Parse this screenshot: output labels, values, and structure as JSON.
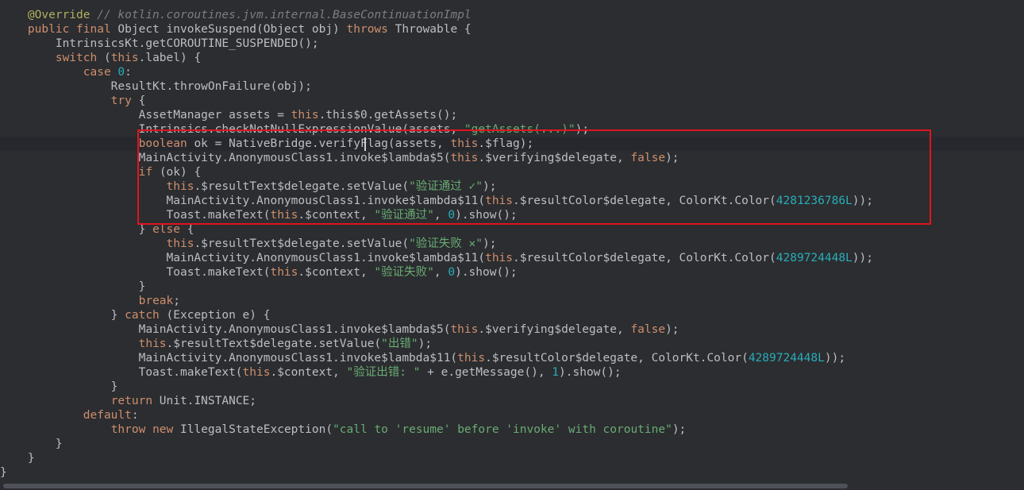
{
  "editor": {
    "colors": {
      "background": "#2b2d30",
      "keyword": "#cf8e6d",
      "annotation": "#b3ae60",
      "comment": "#7a7e85",
      "string": "#6aab73",
      "number": "#2aacb8",
      "identifier": "#bcbec4",
      "highlight_border": "#e0151e"
    },
    "lines": [
      [
        [
          "t-anno",
          "    @Override "
        ],
        [
          "t-cm",
          "// kotlin.coroutines.jvm.internal.BaseContinuationImpl"
        ]
      ],
      [
        [
          "t-id",
          "    "
        ],
        [
          "t-kw",
          "public final "
        ],
        [
          "t-id",
          "Object invokeSuspend(Object obj) "
        ],
        [
          "t-kw",
          "throws "
        ],
        [
          "t-id",
          "Throwable {"
        ]
      ],
      [
        [
          "t-id",
          "        IntrinsicsKt.getCOROUTINE_SUSPENDED();"
        ]
      ],
      [
        [
          "t-id",
          "        "
        ],
        [
          "t-kw",
          "switch "
        ],
        [
          "t-id",
          "("
        ],
        [
          "t-kw",
          "this"
        ],
        [
          "t-id",
          ".label) {"
        ]
      ],
      [
        [
          "t-id",
          "            "
        ],
        [
          "t-kw",
          "case "
        ],
        [
          "t-num",
          "0"
        ],
        [
          "t-id",
          ":"
        ]
      ],
      [
        [
          "t-id",
          "                ResultKt.throwOnFailure(obj);"
        ]
      ],
      [
        [
          "t-id",
          "                "
        ],
        [
          "t-kw",
          "try "
        ],
        [
          "t-id",
          "{"
        ]
      ],
      [
        [
          "t-id",
          "                    AssetManager assets = "
        ],
        [
          "t-kw",
          "this"
        ],
        [
          "t-id",
          ".this$0.getAssets();"
        ]
      ],
      [
        [
          "t-id",
          "                    Intrinsics.checkNotNullExpressionValue(assets, "
        ],
        [
          "t-str",
          "\"getAssets(...)\""
        ],
        [
          "t-id",
          ");"
        ]
      ],
      [
        [
          "t-id",
          "                    "
        ],
        [
          "t-kw",
          "boolean "
        ],
        [
          "t-id",
          "ok = NativeBridge.verifyFlag(assets, "
        ],
        [
          "t-kw",
          "this"
        ],
        [
          "t-id",
          ".$flag);"
        ]
      ],
      [
        [
          "t-id",
          "                    MainActivity.AnonymousClass1.invoke$lambda$5("
        ],
        [
          "t-kw",
          "this"
        ],
        [
          "t-id",
          ".$verifying$delegate, "
        ],
        [
          "t-kw",
          "false"
        ],
        [
          "t-id",
          ");"
        ]
      ],
      [
        [
          "t-id",
          "                    "
        ],
        [
          "t-kw",
          "if "
        ],
        [
          "t-id",
          "(ok) {"
        ]
      ],
      [
        [
          "t-id",
          "                        "
        ],
        [
          "t-kw",
          "this"
        ],
        [
          "t-id",
          ".$resultText$delegate.setValue("
        ],
        [
          "t-str",
          "\"验证通过 ✓\""
        ],
        [
          "t-id",
          ");"
        ]
      ],
      [
        [
          "t-id",
          "                        MainActivity.AnonymousClass1.invoke$lambda$11("
        ],
        [
          "t-kw",
          "this"
        ],
        [
          "t-id",
          ".$resultColor$delegate, ColorKt.Color("
        ],
        [
          "t-num",
          "4281236786L"
        ],
        [
          "t-id",
          "));"
        ]
      ],
      [
        [
          "t-id",
          "                        Toast.makeText("
        ],
        [
          "t-kw",
          "this"
        ],
        [
          "t-id",
          ".$context, "
        ],
        [
          "t-str",
          "\"验证通过\""
        ],
        [
          "t-id",
          ", "
        ],
        [
          "t-num",
          "0"
        ],
        [
          "t-id",
          ").show();"
        ]
      ],
      [
        [
          "t-id",
          "                    } "
        ],
        [
          "t-kw",
          "else "
        ],
        [
          "t-id",
          "{"
        ]
      ],
      [
        [
          "t-id",
          "                        "
        ],
        [
          "t-kw",
          "this"
        ],
        [
          "t-id",
          ".$resultText$delegate.setValue("
        ],
        [
          "t-str",
          "\"验证失败 ✕\""
        ],
        [
          "t-id",
          ");"
        ]
      ],
      [
        [
          "t-id",
          "                        MainActivity.AnonymousClass1.invoke$lambda$11("
        ],
        [
          "t-kw",
          "this"
        ],
        [
          "t-id",
          ".$resultColor$delegate, ColorKt.Color("
        ],
        [
          "t-num",
          "4289724448L"
        ],
        [
          "t-id",
          "));"
        ]
      ],
      [
        [
          "t-id",
          "                        Toast.makeText("
        ],
        [
          "t-kw",
          "this"
        ],
        [
          "t-id",
          ".$context, "
        ],
        [
          "t-str",
          "\"验证失败\""
        ],
        [
          "t-id",
          ", "
        ],
        [
          "t-num",
          "0"
        ],
        [
          "t-id",
          ").show();"
        ]
      ],
      [
        [
          "t-id",
          "                    }"
        ]
      ],
      [
        [
          "t-id",
          "                    "
        ],
        [
          "t-kw",
          "break"
        ],
        [
          "t-id",
          ";"
        ]
      ],
      [
        [
          "t-id",
          "                } "
        ],
        [
          "t-kw",
          "catch "
        ],
        [
          "t-id",
          "(Exception e) {"
        ]
      ],
      [
        [
          "t-id",
          "                    MainActivity.AnonymousClass1.invoke$lambda$5("
        ],
        [
          "t-kw",
          "this"
        ],
        [
          "t-id",
          ".$verifying$delegate, "
        ],
        [
          "t-kw",
          "false"
        ],
        [
          "t-id",
          ");"
        ]
      ],
      [
        [
          "t-id",
          "                    "
        ],
        [
          "t-kw",
          "this"
        ],
        [
          "t-id",
          ".$resultText$delegate.setValue("
        ],
        [
          "t-str",
          "\"出错\""
        ],
        [
          "t-id",
          ");"
        ]
      ],
      [
        [
          "t-id",
          "                    MainActivity.AnonymousClass1.invoke$lambda$11("
        ],
        [
          "t-kw",
          "this"
        ],
        [
          "t-id",
          ".$resultColor$delegate, ColorKt.Color("
        ],
        [
          "t-num",
          "4289724448L"
        ],
        [
          "t-id",
          "));"
        ]
      ],
      [
        [
          "t-id",
          "                    Toast.makeText("
        ],
        [
          "t-kw",
          "this"
        ],
        [
          "t-id",
          ".$context, "
        ],
        [
          "t-str",
          "\"验证出错: \""
        ],
        [
          "t-id",
          " + e.getMessage(), "
        ],
        [
          "t-num",
          "1"
        ],
        [
          "t-id",
          ").show();"
        ]
      ],
      [
        [
          "t-id",
          "                }"
        ]
      ],
      [
        [
          "t-id",
          "                "
        ],
        [
          "t-kw",
          "return "
        ],
        [
          "t-id",
          "Unit.INSTANCE;"
        ]
      ],
      [
        [
          "t-id",
          "            "
        ],
        [
          "t-kw",
          "default"
        ],
        [
          "t-id",
          ":"
        ]
      ],
      [
        [
          "t-id",
          "                "
        ],
        [
          "t-kw",
          "throw new "
        ],
        [
          "t-id",
          "IllegalStateException("
        ],
        [
          "t-str",
          "\"call to 'resume' before 'invoke' with coroutine\""
        ],
        [
          "t-id",
          ");"
        ]
      ],
      [
        [
          "t-id",
          "        }"
        ]
      ],
      [
        [
          "t-id",
          "    }"
        ]
      ],
      [
        [
          "t-id",
          "}"
        ]
      ]
    ]
  }
}
